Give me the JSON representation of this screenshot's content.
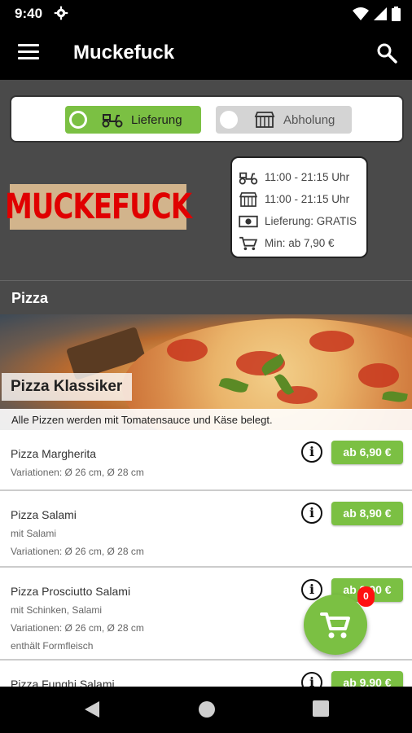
{
  "status_bar": {
    "time": "9:40"
  },
  "app_bar": {
    "title": "Muckefuck"
  },
  "order_mode": {
    "delivery_label": "Lieferung",
    "pickup_label": "Abholung",
    "selected": "delivery"
  },
  "brand": {
    "logo_text": "MUCKEFUCK"
  },
  "info": {
    "delivery_hours": "11:00 - 21:15 Uhr",
    "pickup_hours": "11:00 - 21:15 Uhr",
    "delivery_fee": "Lieferung: GRATIS",
    "minimum_order": "Min: ab 7,90 €"
  },
  "section": {
    "title": "Pizza"
  },
  "category": {
    "title": "Pizza Klassiker",
    "description": "Alle Pizzen werden mit Tomatensauce und Käse belegt."
  },
  "items": [
    {
      "name": "Pizza Margherita",
      "lines": [
        "Variationen: Ø 26 cm, Ø 28 cm"
      ],
      "price": "ab 6,90 €"
    },
    {
      "name": "Pizza Salami",
      "lines": [
        "mit Salami",
        "Variationen: Ø 26 cm, Ø 28 cm"
      ],
      "price": "ab 8,90 €"
    },
    {
      "name": "Pizza Prosciutto Salami",
      "lines": [
        "mit Schinken, Salami",
        "Variationen: Ø 26 cm, Ø 28 cm",
        "enthält Formfleisch"
      ],
      "price": "ab 9,90 €"
    },
    {
      "name": "Pizza Funghi Salami",
      "lines": [],
      "price": "ab 9,90 €"
    }
  ],
  "cart": {
    "count": "0"
  },
  "colors": {
    "accent": "#7bc043",
    "badge": "#ff1010",
    "logo_red": "#e00000"
  }
}
